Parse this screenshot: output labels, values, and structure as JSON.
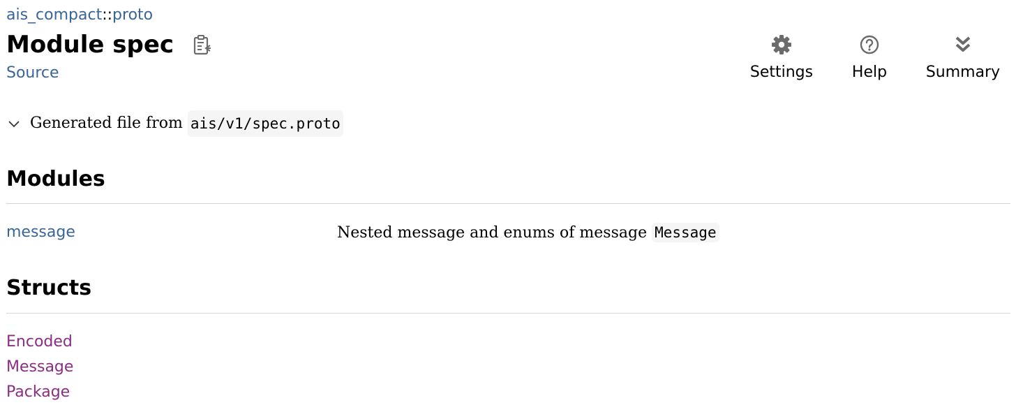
{
  "breadcrumb": {
    "crate": "ais_compact",
    "separator": "::",
    "module": "proto"
  },
  "header": {
    "title": "Module spec",
    "source_label": "Source"
  },
  "toolbar": {
    "settings_label": "Settings",
    "help_label": "Help",
    "summary_label": "Summary"
  },
  "docblock": {
    "text": "Generated file from",
    "code": "ais/v1/spec.proto"
  },
  "modules": {
    "heading": "Modules",
    "items": [
      {
        "name": "message",
        "description": "Nested message and enums of message",
        "code": "Message"
      }
    ]
  },
  "structs": {
    "heading": "Structs",
    "items": [
      {
        "name": "Encoded"
      },
      {
        "name": "Message"
      },
      {
        "name": "Package"
      }
    ]
  },
  "colors": {
    "module_link": "#3a6599",
    "struct_link": "#8b2e83",
    "icon": "#6b6b6b"
  },
  "icons": {
    "copy": "copy-path-icon",
    "settings": "gear-icon",
    "help": "help-circle-icon",
    "summary": "double-chevron-down-icon",
    "toggle": "chevron-down-icon"
  }
}
